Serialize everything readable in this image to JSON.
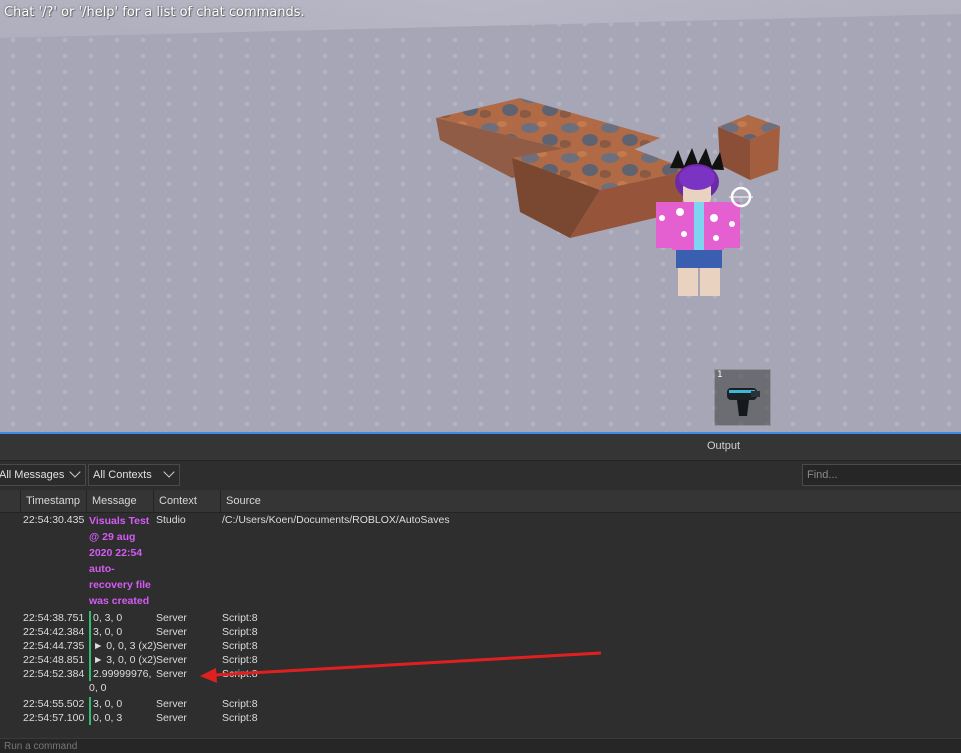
{
  "viewport": {
    "chat_hint": "Chat '/?' or '/help' for a list of chat commands.",
    "hotbar": {
      "slot_number": "1",
      "tool_icon": "blaster-icon"
    }
  },
  "output": {
    "title": "Output",
    "filters": {
      "messages": "All Messages",
      "contexts": "All Contexts",
      "find_placeholder": "Find..."
    },
    "columns": {
      "timestamp": "Timestamp",
      "message": "Message",
      "context": "Context",
      "source": "Source"
    },
    "rows": [
      {
        "timestamp": "22:54:30.435",
        "message_lines": [
          "Visuals Test",
          "@ 29 aug",
          "2020 22:54",
          "auto-",
          "recovery file",
          "was created"
        ],
        "context": "Studio",
        "source": "/C:/Users/Koen/Documents/ROBLOX/AutoSaves"
      },
      {
        "timestamp": "22:54:38.751",
        "message": "0, 3, 0",
        "context": "Server",
        "source": "Script:8"
      },
      {
        "timestamp": "22:54:42.384",
        "message": "3, 0, 0",
        "context": "Server",
        "source": "Script:8"
      },
      {
        "timestamp": "22:54:44.735",
        "message": "► 0, 0, 3 (x2)",
        "context": "Server",
        "source": "Script:8"
      },
      {
        "timestamp": "22:54:48.851",
        "message": "► 3, 0, 0 (x2)",
        "context": "Server",
        "source": "Script:8"
      },
      {
        "timestamp": "22:54:52.384",
        "message_lines": [
          "2.99999976,",
          "0, 0"
        ],
        "context": "Server",
        "source": "Script:8"
      },
      {
        "timestamp": "22:54:55.502",
        "message": "3, 0, 0",
        "context": "Server",
        "source": "Script:8"
      },
      {
        "timestamp": "22:54:57.100",
        "message": "0, 0, 3",
        "context": "Server",
        "source": "Script:8"
      }
    ],
    "command_placeholder": "Run a command"
  },
  "colors": {
    "studio_message": "#d45cf5",
    "server_bar": "#2ebd6b",
    "annotation_arrow": "#e02020",
    "panel_bg": "#2e2e2e"
  }
}
